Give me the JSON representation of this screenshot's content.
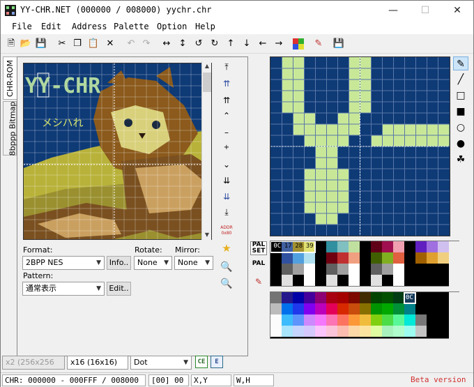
{
  "window": {
    "title": "YY-CHR.NET (000000 / 008000) yychr.chr"
  },
  "menu": [
    "File",
    "Edit",
    "Address",
    "Palette",
    "Option",
    "Help"
  ],
  "tabs": {
    "chr_rom": "CHR-ROM",
    "bitmap": "8bppp Bitmap"
  },
  "chr_overlay": {
    "logo": "YY-CHR",
    "kana": "メシハれ"
  },
  "nav": {
    "addr": "ADDR",
    "addr_val": "0x80"
  },
  "format": {
    "label": "Format:",
    "value": "2BPP NES",
    "info_button": "Info.."
  },
  "rotate": {
    "label": "Rotate:",
    "value": "None"
  },
  "mirror": {
    "label": "Mirror:",
    "value": "None"
  },
  "pattern": {
    "label": "Pattern:",
    "value": "通常表示",
    "edit_button": "Edit.."
  },
  "palette": {
    "set_label": "PAL SET",
    "pal_label": "PAL",
    "selected": [
      "0C",
      "17",
      "28",
      "39"
    ],
    "swatch_selected": "0C",
    "accent": "#0e3a76"
  },
  "bottom": {
    "zoom": "x2 (256x256",
    "grid": "x16 (16x16)",
    "mode": "Dot"
  },
  "status": {
    "chr": "CHR: 000000 - 000FFF / 008000",
    "offset": "[00] 00",
    "xy": "X,Y",
    "wh": "W,H",
    "beta": "Beta version"
  }
}
